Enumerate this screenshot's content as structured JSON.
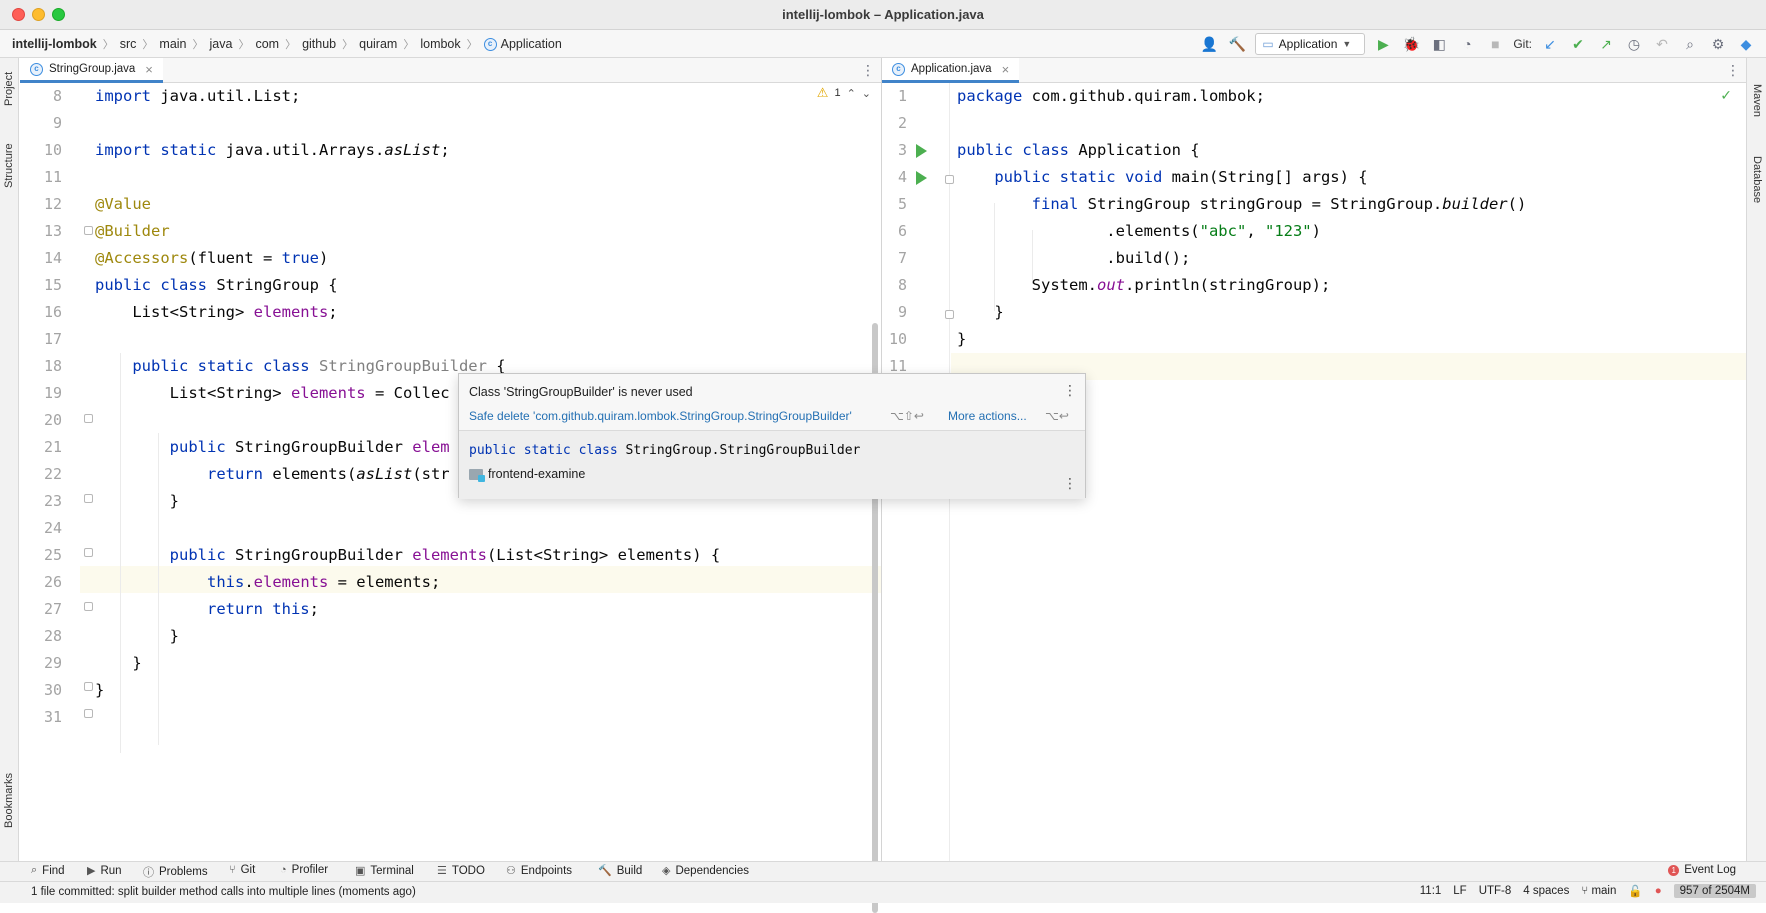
{
  "window": {
    "title": "intellij-lombok – Application.java"
  },
  "breadcrumbs": [
    "intellij-lombok",
    "src",
    "main",
    "java",
    "com",
    "github",
    "quiram",
    "lombok",
    "Application"
  ],
  "toolbar": {
    "run_config": "Application",
    "git_label": "Git:"
  },
  "side_tabs": {
    "left": [
      "Project",
      "Structure",
      "Bookmarks"
    ],
    "right": [
      "Maven",
      "Database"
    ]
  },
  "left_editor": {
    "tab_label": "StringGroup.java",
    "warning_count": "1",
    "line_numbers": [
      "8",
      "9",
      "10",
      "11",
      "12",
      "13",
      "14",
      "15",
      "16",
      "17",
      "18",
      "19",
      "20",
      "21",
      "22",
      "23",
      "24",
      "25",
      "26",
      "27",
      "28",
      "29",
      "30",
      "31"
    ]
  },
  "right_editor": {
    "tab_label": "Application.java",
    "line_numbers": [
      "1",
      "2",
      "3",
      "4",
      "5",
      "6",
      "7",
      "8",
      "9",
      "10",
      "11"
    ]
  },
  "popup": {
    "message": "Class 'StringGroupBuilder' is never used",
    "safe_delete": "Safe delete 'com.github.quiram.lombok.StringGroup.StringGroupBuilder'",
    "safe_delete_shortcut": "⌥⇧↩",
    "more_actions": "More actions...",
    "more_actions_shortcut": "⌥↩",
    "signature": "public static class StringGroup.StringGroupBuilder",
    "module": "frontend-examine"
  },
  "tool_windows": [
    "Find",
    "Run",
    "Problems",
    "Git",
    "Profiler",
    "Terminal",
    "TODO",
    "Endpoints",
    "Build",
    "Dependencies"
  ],
  "event_log": "Event Log",
  "status": {
    "message": "1 file committed: split builder method calls into multiple lines (moments ago)",
    "position": "11:1",
    "line_sep": "LF",
    "encoding": "UTF-8",
    "indent": "4 spaces",
    "branch": "main",
    "memory": "957 of 2504M"
  }
}
